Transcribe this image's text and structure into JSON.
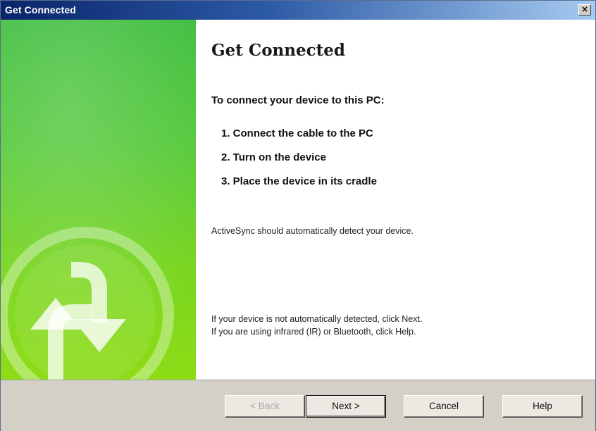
{
  "window": {
    "title": "Get Connected",
    "close_label": "×"
  },
  "content": {
    "heading": "Get Connected",
    "intro": "To connect your device to this PC:",
    "steps": [
      "1. Connect the cable to the PC",
      "2. Turn on the device",
      "3. Place the device in its cradle"
    ],
    "auto_detect": "ActiveSync should automatically detect your device.",
    "footnote_1": "If your device is not automatically detected, click Next.",
    "footnote_2": "If you are using infrared (IR) or Bluetooth, click Help."
  },
  "buttons": {
    "back": "< Back",
    "next": "Next >",
    "cancel": "Cancel",
    "help": "Help"
  },
  "colors": {
    "title_bar": "#0a246a",
    "side_panel_green": "#55c93a",
    "button_face": "#d4d0c8"
  },
  "icons": {
    "sync_emblem": "activesync-sync-icon",
    "close": "close-icon"
  }
}
